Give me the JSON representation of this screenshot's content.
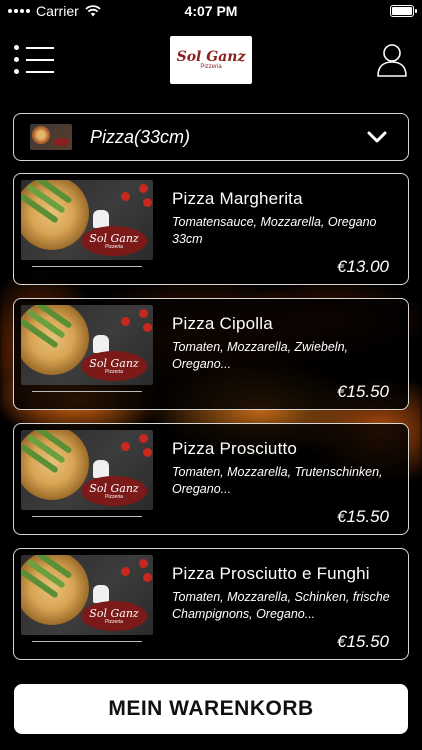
{
  "status_bar": {
    "carrier": "Carrier",
    "time": "4:07 PM"
  },
  "header": {
    "logo_text": "Sol Ganz",
    "logo_subtitle": "Pizzeria"
  },
  "category": {
    "selected": "Pizza(33cm)"
  },
  "products": [
    {
      "name": "Pizza Margherita",
      "description": "Tomatensauce, Mozzarella, Oregano 33cm",
      "price": "€13.00"
    },
    {
      "name": "Pizza Cipolla",
      "description": "Tomaten, Mozzarella, Zwiebeln, Oregano...",
      "price": "€15.50"
    },
    {
      "name": "Pizza Prosciutto",
      "description": "Tomaten, Mozzarella, Trutenschinken, Oregano...",
      "price": "€15.50"
    },
    {
      "name": "Pizza Prosciutto e Funghi",
      "description": "Tomaten, Mozzarella, Schinken, frische Champignons, Oregano...",
      "price": "€15.50"
    }
  ],
  "cart": {
    "label": "MEIN WARENKORB"
  },
  "colors": {
    "background": "#000000",
    "card_border": "#d7d7d7",
    "button_bg": "#ffffff",
    "brand_red": "#8b1f1f"
  }
}
